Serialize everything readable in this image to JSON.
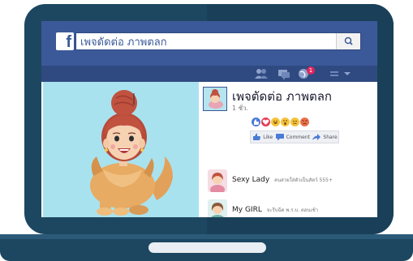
{
  "colors": {
    "facebook_blue": "#3b5998",
    "facebook_dark_blue": "#2f4a80",
    "laptop_body": "#1d4761",
    "photo_background": "#a9e2ef",
    "notification_red": "#e0245e"
  },
  "search": {
    "logo_letter": "f",
    "value": "เพจดัดต่อ ภาพตลก",
    "button_icon": "search-icon"
  },
  "nav": {
    "icons": [
      "friends-icon",
      "messages-icon",
      "notifications-globe-icon",
      "settings-icon",
      "chevron-down-icon"
    ],
    "notification_count": "1"
  },
  "post": {
    "page_name": "เพจตัดต่อ ภาพตลก",
    "meta": "1 ชั่ว.",
    "reactions": [
      "like",
      "love",
      "haha",
      "wow",
      "sad",
      "angry"
    ],
    "actions": [
      {
        "icon": "like-icon",
        "label": "Like"
      },
      {
        "icon": "comment-icon",
        "label": "Comment"
      },
      {
        "icon": "share-icon",
        "label": "Share"
      }
    ]
  },
  "comments": [
    {
      "name": "Sexy Lady",
      "text": "คนสวยใส่ตัวเป็นสัตว์ 555+"
    },
    {
      "name": "My GIRL",
      "text": "จะรีบฉีด พ.ร.บ. ตอนเช้า"
    }
  ]
}
